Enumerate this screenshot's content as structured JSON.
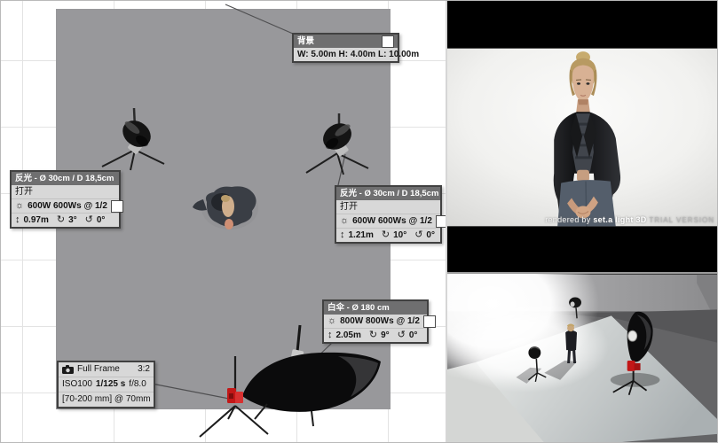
{
  "colors": {
    "grid-line": "#e3e3e3",
    "floor-gray": "#98989b",
    "panel-title-bg": "#6f6f70",
    "panel-body-bg": "#d8d8d8",
    "panel-border": "#414141",
    "camera-red": "#c21717"
  },
  "icons": {
    "flash": "☼",
    "height": "↕",
    "tilt": "↻",
    "rotation": "↺"
  },
  "panels": {
    "background": {
      "title": "背景",
      "dimensions": "W: 5.00m H: 4.00m L: 10.00m"
    },
    "reflector_left": {
      "title": "反光 - Ø 30cm / D 18,5cm",
      "state": "打开",
      "power": "600W 600Ws @ 1/2",
      "height": "0.97m",
      "tilt": "3°",
      "rotation": "0°"
    },
    "reflector_right": {
      "title": "反光 - Ø 30cm / D 18,5cm",
      "state": "打开",
      "power": "600W 600Ws @ 1/2",
      "height": "1.21m",
      "tilt": "10°",
      "rotation": "0°"
    },
    "umbrella": {
      "title": "白伞 - Ø 180 cm",
      "power": "800W 800Ws @ 1/2",
      "height": "2.05m",
      "tilt": "9°",
      "rotation": "0°"
    },
    "camera": {
      "sensor": "Full Frame",
      "aspect": "3:2",
      "iso": "ISO100",
      "shutter": "1/125 s",
      "aperture": "f/8.0",
      "lens": "[70-200 mm] @ 70mm"
    }
  },
  "preview": {
    "watermark_prefix": "rendered by",
    "watermark_brand": "set.a light 3D",
    "watermark_suffix": "TRIAL VERSION"
  }
}
